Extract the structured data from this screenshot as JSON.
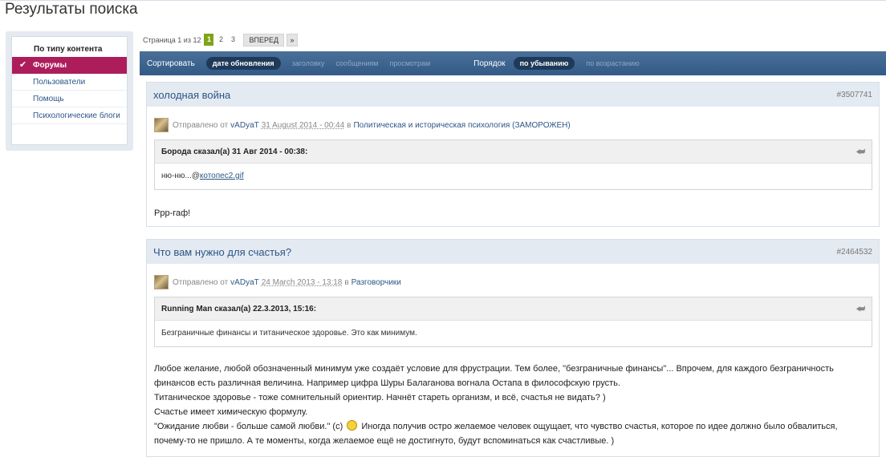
{
  "page": {
    "title": "Результаты поиска"
  },
  "sidebar": {
    "heading": "По типу контента",
    "items": [
      {
        "label": "Форумы",
        "active": true
      },
      {
        "label": "Пользователи"
      },
      {
        "label": "Помощь"
      },
      {
        "label": "Психологические блоги"
      }
    ]
  },
  "pagination": {
    "label": "Страница 1 из 12",
    "pages": [
      "1",
      "2",
      "3"
    ],
    "next_label": "ВПЕРЕД",
    "last_label": "»"
  },
  "sort": {
    "label": "Сортировать",
    "options": [
      "дате обновления",
      "заголовку",
      "сообщениям",
      "просмотрам"
    ],
    "order_label": "Порядок",
    "order_options": [
      "по убыванию",
      "по возрастанию"
    ]
  },
  "results": [
    {
      "title": "холодная война",
      "id": "#3507741",
      "sent_prefix": "Отправлено от",
      "author": "vADyaT",
      "date": "31 August 2014 - 00:44",
      "in_word": "в",
      "forum": "Политическая и историческая психология (ЗАМОРОЖЕН)",
      "quote_header": "Борода сказал(а) 31 Авг 2014 - 00:38:",
      "quote_text": "ню-ню...",
      "quote_attachment": "котопес2.gif",
      "text": "Ррр-гаф!"
    },
    {
      "title": "Что вам нужно для счастья?",
      "id": "#2464532",
      "sent_prefix": "Отправлено от",
      "author": "vADyaT",
      "date": "24 March 2013 - 13:18",
      "in_word": "в",
      "forum": "Разговорчики",
      "quote_header": "Running Man сказал(а) 22.3.2013, 15:16:",
      "quote_text": "Безграничные финансы и титаническое здоровье. Это как минимум.",
      "lines": [
        "Любое желание, любой обозначенный минимум уже создаёт условие для фрустрации. Тем более, \"безграничные финансы\"... Впрочем, для каждого безграничность финансов есть различная величина. Например цифра Шуры Балаганова вогнала Остапа в философскую грусть.",
        "Титаническое здоровье - тоже сомнительный ориентир. Начнёт стареть организм, и всё, счастья не видать? )",
        "Счастье имеет химическую формулу.",
        "\"Ожидание любви - больше самой любви.\" (с)",
        "Иногда получив остро желаемое человек ощущает, что чувство счастья, которое по идее должно было обвалиться, почему-то не пришло. А те моменты, когда желаемое ещё не достигнуто, будут вспоминаться как счастливые. )"
      ]
    }
  ]
}
